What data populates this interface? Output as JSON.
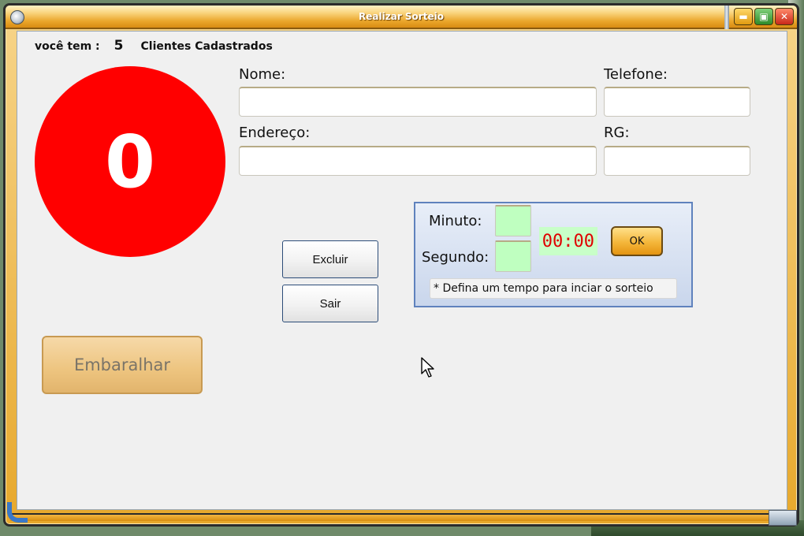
{
  "window": {
    "title": "Realizar Sorteio",
    "controls": {
      "minimize": "▬",
      "maximize": "▣",
      "close": "✕"
    }
  },
  "header": {
    "prefix": "você tem :",
    "count": "5",
    "suffix": "Clientes Cadastrados"
  },
  "ball": {
    "number": "0",
    "color": "#ff0000"
  },
  "form": {
    "name_label": "Nome:",
    "name_value": "",
    "phone_label": "Telefone:",
    "phone_value": "",
    "address_label": "Endereço:",
    "address_value": "",
    "rg_label": "RG:",
    "rg_value": ""
  },
  "buttons": {
    "delete": "Excluir",
    "exit": "Sair",
    "shuffle": "Embaralhar"
  },
  "timer": {
    "minute_label": "Minuto:",
    "second_label": "Segundo:",
    "clock_display": "00:00",
    "ok_label": "OK",
    "hint": "* Defina um tempo para inciar o sorteio"
  },
  "colors": {
    "accent_orange": "#e7a82c",
    "timer_green": "#bfffc0",
    "clock_red": "#e00000"
  }
}
